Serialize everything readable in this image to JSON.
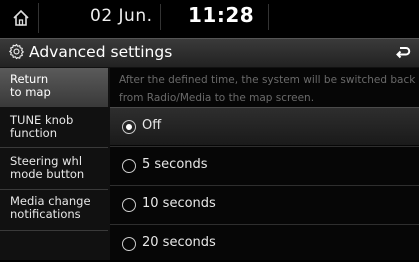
{
  "status": {
    "date": "02 Jun.",
    "time": "11:28"
  },
  "header": {
    "title": "Advanced settings"
  },
  "sidebar": {
    "items": [
      {
        "line1": "Return",
        "line2": "to map",
        "active": true
      },
      {
        "line1": "TUNE knob",
        "line2": "function",
        "active": false
      },
      {
        "line1": "Steering whl",
        "line2": "mode button",
        "active": false
      },
      {
        "line1": "Media change",
        "line2": "notifications",
        "active": false
      }
    ]
  },
  "content": {
    "description": "After the defined time, the system will be switched back from Radio/Media to the map screen.",
    "options": [
      {
        "label": "Off",
        "selected": true
      },
      {
        "label": "5 seconds",
        "selected": false
      },
      {
        "label": "10 seconds",
        "selected": false
      },
      {
        "label": "20 seconds",
        "selected": false
      }
    ]
  },
  "icons": {
    "home": "home-icon",
    "settings": "gear-icon",
    "back": "back-icon"
  }
}
